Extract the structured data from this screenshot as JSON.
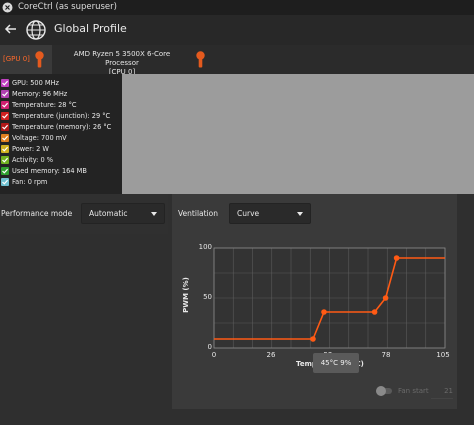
{
  "window": {
    "title": "CoreCtrl (as superuser)"
  },
  "header": {
    "title": "Global Profile"
  },
  "tabs": [
    {
      "label": "[GPU 0]"
    },
    {
      "label_line1": "AMD Ryzen 5 3500X 6-Core Processor",
      "label_line2": "[CPU 0]"
    }
  ],
  "sensors": [
    {
      "label": "GPU: 500 MHz",
      "color": "#c040c0"
    },
    {
      "label": "Memory: 96 MHz",
      "color": "#b040b0"
    },
    {
      "label": "Temperature: 28 °C",
      "color": "#d02070"
    },
    {
      "label": "Temperature (junction): 29 °C",
      "color": "#d02020"
    },
    {
      "label": "Temperature (memory): 26 °C",
      "color": "#b01818"
    },
    {
      "label": "Voltage: 700 mV",
      "color": "#e08020"
    },
    {
      "label": "Power: 2 W",
      "color": "#d0b020"
    },
    {
      "label": "Activity: 0 %",
      "color": "#70b020"
    },
    {
      "label": "Used memory: 164 MB",
      "color": "#30a030"
    },
    {
      "label": "Fan: 0 rpm",
      "color": "#70c0d0"
    }
  ],
  "performance": {
    "label": "Performance mode",
    "value": "Automatic"
  },
  "ventilation": {
    "label": "Ventilation",
    "value": "Curve"
  },
  "chart_data": {
    "type": "line",
    "xlabel": "Temperature (°C)",
    "ylabel": "PWM (%)",
    "xlim": [
      0,
      105
    ],
    "ylim": [
      0,
      100
    ],
    "x_ticks": [
      "0",
      "26",
      "52",
      "78",
      "105"
    ],
    "y_ticks": [
      "0",
      "50",
      "100"
    ],
    "grid": true,
    "series": [
      {
        "x": [
          0,
          45,
          50,
          73,
          78,
          83,
          105
        ],
        "y": [
          9,
          9,
          36,
          36,
          50,
          90,
          90
        ],
        "color": "#ff5a14"
      }
    ],
    "tooltip": "45°C 9%"
  },
  "fan_start": {
    "label": "Fan start",
    "value": "21"
  }
}
